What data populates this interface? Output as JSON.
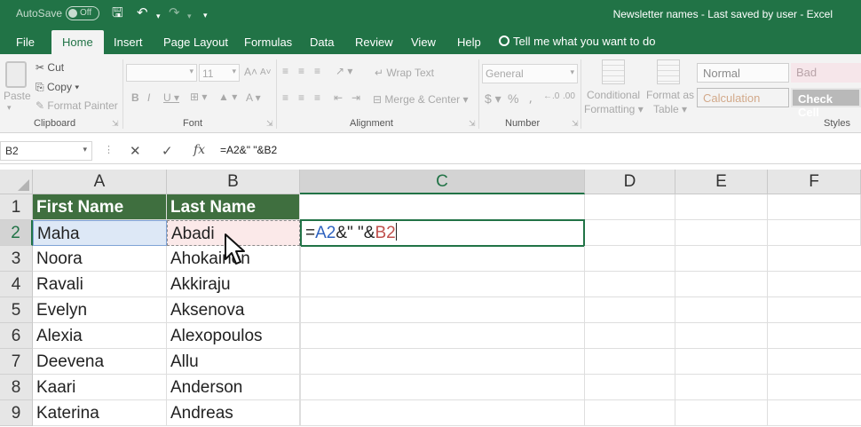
{
  "titlebar": {
    "autosave_label": "AutoSave",
    "autosave_state": "Off",
    "doc_title": "Newsletter names  -  Last saved by user  -  Excel"
  },
  "tabs": [
    "File",
    "Home",
    "Insert",
    "Page Layout",
    "Formulas",
    "Data",
    "Review",
    "View",
    "Help"
  ],
  "tell_me": "Tell me what you want to do",
  "ribbon": {
    "clipboard": {
      "paste": "Paste",
      "cut": "Cut",
      "copy": "Copy",
      "format_painter": "Format Painter",
      "label": "Clipboard"
    },
    "font": {
      "size": "11",
      "label": "Font"
    },
    "alignment": {
      "wrap_text": "Wrap Text",
      "merge_center": "Merge & Center",
      "label": "Alignment"
    },
    "number": {
      "format": "General",
      "label": "Number"
    },
    "styles": {
      "conditional_formatting": [
        "Conditional",
        "Formatting"
      ],
      "format_as_table": [
        "Format as",
        "Table"
      ],
      "normal": "Normal",
      "bad": "Bad",
      "calculation": "Calculation",
      "check_cell": "Check Cell",
      "label": "Styles"
    }
  },
  "formula_bar": {
    "name_box": "B2",
    "formula": "=A2&\" \"&B2"
  },
  "grid": {
    "columns": [
      "A",
      "B",
      "C",
      "D",
      "E",
      "F"
    ],
    "rows": [
      "1",
      "2",
      "3",
      "4",
      "5",
      "6",
      "7",
      "8",
      "9"
    ],
    "header_row": [
      "First Name",
      "Last Name"
    ],
    "data": [
      [
        "Maha",
        "Abadi"
      ],
      [
        "Noora",
        "Ahokainen"
      ],
      [
        "Ravali",
        "Akkiraju"
      ],
      [
        "Evelyn",
        "Aksenova"
      ],
      [
        "Alexia",
        "Alexopoulos"
      ],
      [
        "Deevena",
        "Allu"
      ],
      [
        "Kaari",
        "Anderson"
      ],
      [
        "Katerina",
        "Andreas"
      ]
    ],
    "active_cell_formula": {
      "eq": "=",
      "ref1": "A2",
      "mid": "&\" \"&",
      "ref2": "B2"
    }
  },
  "colors": {
    "accent": "#217346",
    "header_fill": "#3f6f3f",
    "ref_blue": "#2e62bf",
    "ref_red": "#c0504d"
  }
}
